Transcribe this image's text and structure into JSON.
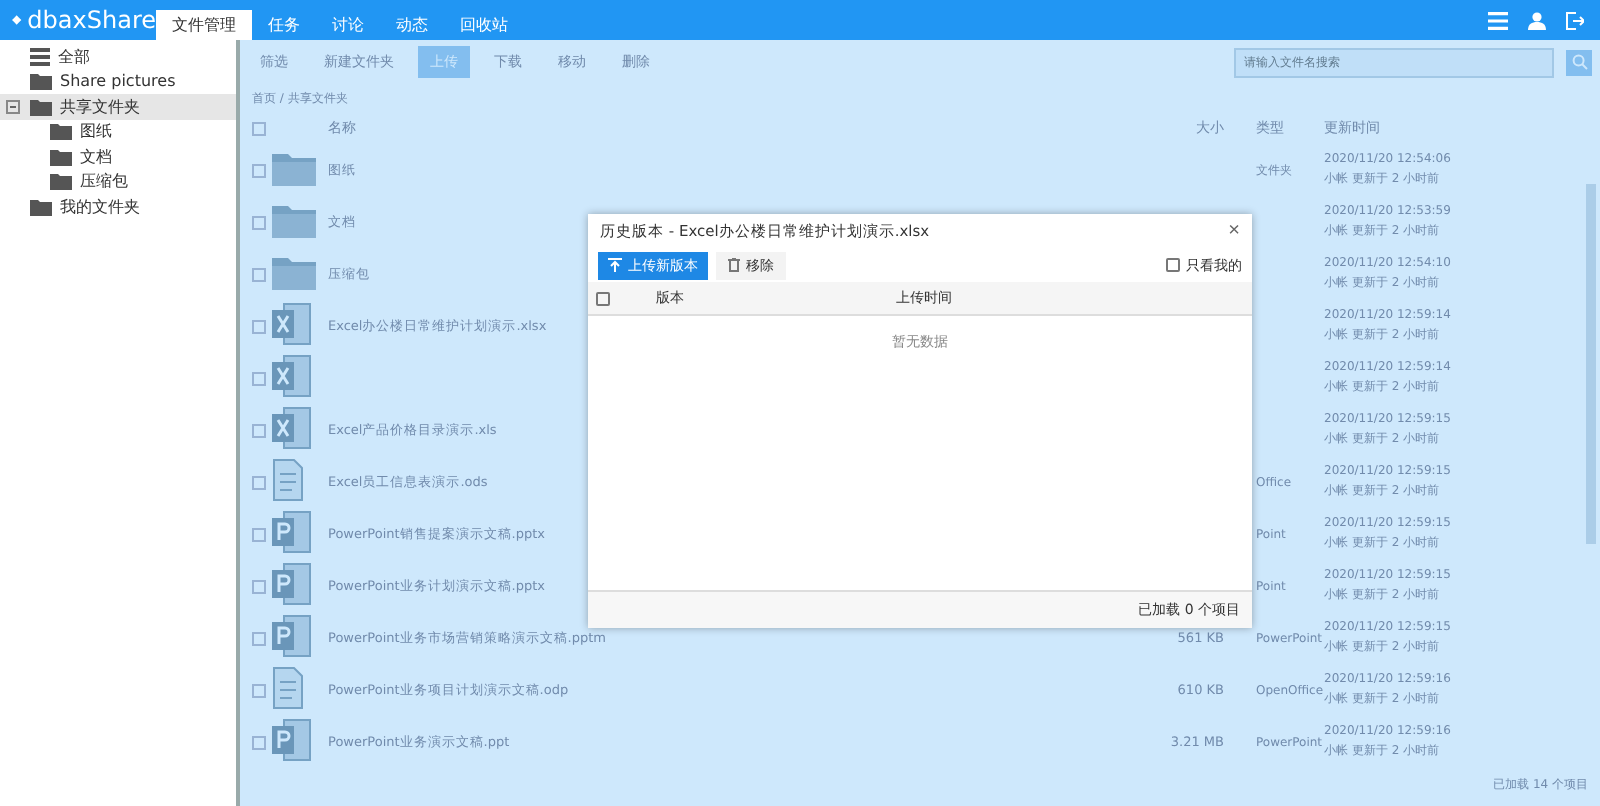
{
  "topbar": {
    "logo": "dbaxShare",
    "tabs": [
      {
        "label": "文件管理",
        "selected": true
      },
      {
        "label": "任务",
        "selected": false
      },
      {
        "label": "讨论",
        "selected": false
      },
      {
        "label": "动态",
        "selected": false
      },
      {
        "label": "回收站",
        "selected": false
      }
    ]
  },
  "sidebar": {
    "items": [
      {
        "label": "全部",
        "kind": "all",
        "selected": false
      },
      {
        "label": "Share pictures",
        "kind": "folder",
        "selected": false
      },
      {
        "label": "共享文件夹",
        "kind": "folder",
        "selected": true,
        "expanded": true,
        "children": [
          {
            "label": "图纸",
            "kind": "folder",
            "selected": false
          },
          {
            "label": "文档",
            "kind": "folder",
            "selected": false
          },
          {
            "label": "压缩包",
            "kind": "folder",
            "selected": false
          }
        ]
      },
      {
        "label": "我的文件夹",
        "kind": "folder",
        "selected": false
      }
    ]
  },
  "toolbar": [
    "筛选",
    "新建文件夹",
    "上传",
    "下载",
    "移动",
    "删除"
  ],
  "search": {
    "placeholder": "请输入文件名搜索"
  },
  "breadcrumb": "首页 / 共享文件夹",
  "table": {
    "select_all": {
      "checked": false
    },
    "columns": [
      "名称",
      "大小",
      "类型",
      "更新时间"
    ],
    "rows": [
      {
        "selected": false,
        "kind": "folder",
        "name": "图纸",
        "type": "文件夹",
        "time": "2020/11/20 12:54:06",
        "by": "小帐 更新于 2 小时前"
      },
      {
        "selected": false,
        "kind": "folder",
        "name": "文档",
        "time": "2020/11/20 12:53:59",
        "by": "小帐 更新于 2 小时前"
      },
      {
        "selected": false,
        "kind": "folder",
        "name": "压缩包",
        "time": "2020/11/20 12:54:10",
        "by": "小帐 更新于 2 小时前"
      },
      {
        "selected": false,
        "kind": "xls",
        "name": "Excel办公楼日常维护计划演示.xlsx",
        "time": "2020/11/20 12:59:14",
        "by": "小帐 更新于 2 小时前"
      },
      {
        "selected": false,
        "kind": "xls",
        "time": "2020/11/20 12:59:14",
        "by": "小帐 更新于 2 小时前"
      },
      {
        "selected": false,
        "kind": "xls",
        "name": "Excel产品价格目录演示.xls",
        "time": "2020/11/20 12:59:15",
        "by": "小帐 更新于 2 小时前"
      },
      {
        "selected": false,
        "kind": "ods",
        "name": "Excel员工信息表演示.ods",
        "type": "Office",
        "time": "2020/11/20 12:59:15",
        "by": "小帐 更新于 2 小时前"
      },
      {
        "selected": false,
        "kind": "ppt",
        "name": "PowerPoint销售提案演示文稿.pptx",
        "type": "Point",
        "time": "2020/11/20 12:59:15",
        "by": "小帐 更新于 2 小时前"
      },
      {
        "selected": false,
        "kind": "ppt",
        "name": "PowerPoint业务计划演示文稿.pptx",
        "type": "Point",
        "time": "2020/11/20 12:59:15",
        "by": "小帐 更新于 2 小时前"
      },
      {
        "selected": false,
        "kind": "ppt",
        "name": "PowerPoint业务市场营销策略演示文稿.pptm",
        "size": "561 KB",
        "type": "PowerPoint",
        "time": "2020/11/20 12:59:15",
        "by": "小帐 更新于 2 小时前"
      },
      {
        "selected": false,
        "kind": "odp",
        "name": "PowerPoint业务项目计划演示文稿.odp",
        "size": "610 KB",
        "type": "OpenOffice",
        "time": "2020/11/20 12:59:16",
        "by": "小帐 更新于 2 小时前"
      },
      {
        "selected": false,
        "kind": "ppt",
        "name": "PowerPoint业务演示文稿.ppt",
        "size": "3.21 MB",
        "type": "PowerPoint",
        "time": "2020/11/20 12:59:16",
        "by": "小帐 更新于 2 小时前"
      }
    ]
  },
  "status": "已加载 14 个项目",
  "dialog": {
    "close": "×",
    "title": "历史版本 - Excel办公楼日常维护计划演示.xlsx",
    "upload_button": "上传新版本",
    "remove_button": "移除",
    "only_mine": {
      "label": "只看我的",
      "checked": false
    },
    "select_all": {
      "checked": false
    },
    "columns": [
      "版本",
      "上传时间"
    ],
    "empty": "暂无数据",
    "footer": "已加载 0 个项目"
  }
}
